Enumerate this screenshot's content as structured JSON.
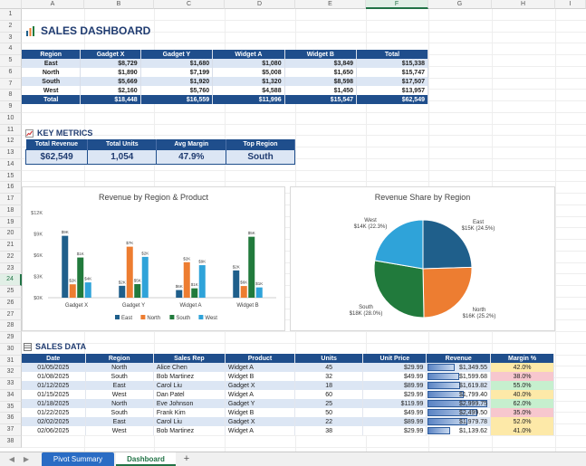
{
  "columns": [
    "A",
    "B",
    "C",
    "D",
    "E",
    "F",
    "G",
    "H",
    "I"
  ],
  "rows": [
    "1",
    "2",
    "3",
    "4",
    "5",
    "6",
    "7",
    "8",
    "9",
    "10",
    "11",
    "12",
    "13",
    "14",
    "15",
    "16",
    "17",
    "18",
    "19",
    "20",
    "21",
    "22",
    "23",
    "24",
    "25",
    "26",
    "27",
    "28",
    "29",
    "30",
    "31",
    "32",
    "33",
    "34",
    "35",
    "36",
    "37",
    "38"
  ],
  "selected_row": "24",
  "selected_col": "F",
  "dashboard_title": "SALES DASHBOARD",
  "summary": {
    "headers": [
      "Region",
      "Gadget X",
      "Gadget Y",
      "Widget A",
      "Widget B",
      "Total"
    ],
    "rows": [
      [
        "East",
        "$8,729",
        "$1,680",
        "$1,080",
        "$3,849",
        "$15,338"
      ],
      [
        "North",
        "$1,890",
        "$7,199",
        "$5,008",
        "$1,650",
        "$15,747"
      ],
      [
        "South",
        "$5,669",
        "$1,920",
        "$1,320",
        "$8,598",
        "$17,507"
      ],
      [
        "West",
        "$2,160",
        "$5,760",
        "$4,588",
        "$1,450",
        "$13,957"
      ]
    ],
    "total": [
      "Total",
      "$18,448",
      "$16,559",
      "$11,996",
      "$15,547",
      "$62,549"
    ]
  },
  "key_metrics": {
    "title": "KEY METRICS",
    "labels": [
      "Total Revenue",
      "Total Units",
      "Avg Margin",
      "Top Region"
    ],
    "values": [
      "$62,549",
      "1,054",
      "47.9%",
      "South"
    ]
  },
  "chart_data": [
    {
      "type": "bar",
      "title": "Revenue by Region & Product",
      "categories": [
        "Gadget X",
        "Gadget Y",
        "Widget A",
        "Widget B"
      ],
      "series": [
        {
          "name": "East",
          "values": [
            8729,
            1680,
            1080,
            3849
          ],
          "color": "#1f5f8b"
        },
        {
          "name": "North",
          "values": [
            1890,
            7199,
            5008,
            1650
          ],
          "color": "#ed7d31"
        },
        {
          "name": "South",
          "values": [
            5669,
            1920,
            1320,
            8598
          ],
          "color": "#217a3c"
        },
        {
          "name": "West",
          "values": [
            2160,
            5760,
            4588,
            1450
          ],
          "color": "#2fa3d9"
        }
      ],
      "data_labels": [
        [
          "$9K",
          "$2K",
          "$6K",
          "$2K"
        ],
        [
          "$2K",
          "$7K",
          "$2K",
          "$6K"
        ],
        [
          "$1K",
          "$5K",
          "$1K",
          "$5K"
        ],
        [
          "$4K",
          "$2K",
          "$9K",
          "$1K"
        ]
      ],
      "yticks": [
        "$0K",
        "$3K",
        "$6K",
        "$9K",
        "$12K"
      ],
      "ylim": [
        0,
        12000
      ],
      "legend": "bottom",
      "grid": false
    },
    {
      "type": "pie",
      "title": "Revenue Share by Region",
      "slices": [
        {
          "name": "East",
          "value": 15338,
          "label": "East",
          "sub": "$15K (24.5%)",
          "color": "#1f5f8b"
        },
        {
          "name": "North",
          "value": 15747,
          "label": "North",
          "sub": "$16K (25.2%)",
          "color": "#ed7d31"
        },
        {
          "name": "South",
          "value": 17507,
          "label": "South",
          "sub": "$18K (28.0%)",
          "color": "#217a3c"
        },
        {
          "name": "West",
          "value": 13957,
          "label": "West",
          "sub": "$14K (22.3%)",
          "color": "#2fa3d9"
        }
      ]
    }
  ],
  "sales_data": {
    "title": "SALES DATA",
    "headers": [
      "Date",
      "Region",
      "Sales Rep",
      "Product",
      "Units",
      "Unit Price",
      "Revenue",
      "Margin %"
    ],
    "rows": [
      [
        "01/05/2025",
        "North",
        "Alice Chen",
        "Widget A",
        "45",
        "$29.99",
        "$1,349.55",
        "42.0%"
      ],
      [
        "01/08/2025",
        "South",
        "Bob Martinez",
        "Widget B",
        "32",
        "$49.99",
        "$1,599.68",
        "38.0%"
      ],
      [
        "01/12/2025",
        "East",
        "Carol Liu",
        "Gadget X",
        "18",
        "$89.99",
        "$1,619.82",
        "55.0%"
      ],
      [
        "01/15/2025",
        "West",
        "Dan Patel",
        "Widget A",
        "60",
        "$29.99",
        "$1,799.40",
        "40.0%"
      ],
      [
        "01/18/2025",
        "North",
        "Eve Johnson",
        "Gadget Y",
        "25",
        "$119.99",
        "$2,999.75",
        "62.0%"
      ],
      [
        "01/22/2025",
        "South",
        "Frank Kim",
        "Widget B",
        "50",
        "$49.99",
        "$2,499.50",
        "35.0%"
      ],
      [
        "02/02/2025",
        "East",
        "Carol Liu",
        "Gadget X",
        "22",
        "$89.99",
        "$1,979.78",
        "52.0%"
      ],
      [
        "02/06/2025",
        "West",
        "Bob Martinez",
        "Widget A",
        "38",
        "$29.99",
        "$1,139.62",
        "41.0%"
      ]
    ],
    "revenue_fraction": [
      0.45,
      0.53,
      0.54,
      0.6,
      1.0,
      0.83,
      0.66,
      0.38
    ],
    "margin_colors": [
      "#fde9a8",
      "#f7c7ce",
      "#c6efce",
      "#fde9a8",
      "#c6efce",
      "#f7c7ce",
      "#fde9a8",
      "#fde9a8"
    ]
  },
  "tabs": [
    "Pivot Summary",
    "Dashboard"
  ],
  "active_tab": "Dashboard",
  "add_tab_label": "+"
}
